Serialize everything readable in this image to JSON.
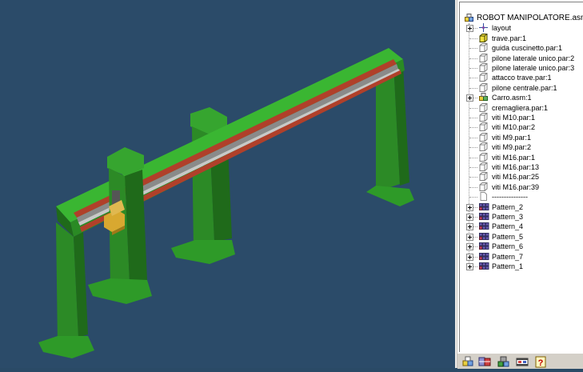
{
  "tree": {
    "root": {
      "label": "ROBOT MANIPOLATORE.asm",
      "icon": "assembly-icon"
    },
    "items": [
      {
        "label": "layout",
        "icon": "layout-axes-icon",
        "expandable": true,
        "level": 1
      },
      {
        "label": "trave.par:1",
        "icon": "part-active-icon",
        "expandable": false,
        "level": 1
      },
      {
        "label": "guida cuscinetto.par:1",
        "icon": "part-icon",
        "expandable": false,
        "level": 1
      },
      {
        "label": "pilone laterale unico.par:2",
        "icon": "part-icon",
        "expandable": false,
        "level": 1
      },
      {
        "label": "pilone laterale unico.par:3",
        "icon": "part-icon",
        "expandable": false,
        "level": 1
      },
      {
        "label": "attacco trave.par:1",
        "icon": "part-icon",
        "expandable": false,
        "level": 1
      },
      {
        "label": "pilone centrale.par:1",
        "icon": "part-icon",
        "expandable": false,
        "level": 1
      },
      {
        "label": "Carro.asm:1",
        "icon": "subassembly-icon",
        "expandable": true,
        "level": 1
      },
      {
        "label": "cremagliera.par:1",
        "icon": "part-icon",
        "expandable": false,
        "level": 1
      },
      {
        "label": "viti M10.par:1",
        "icon": "part-icon",
        "expandable": false,
        "level": 1
      },
      {
        "label": "viti M10.par:2",
        "icon": "part-icon",
        "expandable": false,
        "level": 1
      },
      {
        "label": "viti M9.par:1",
        "icon": "part-icon",
        "expandable": false,
        "level": 1
      },
      {
        "label": "viti M9.par:2",
        "icon": "part-icon",
        "expandable": false,
        "level": 1
      },
      {
        "label": "viti M16.par:1",
        "icon": "part-icon",
        "expandable": false,
        "level": 1
      },
      {
        "label": "viti M16.par:13",
        "icon": "part-icon",
        "expandable": false,
        "level": 1
      },
      {
        "label": "viti M16.par:25",
        "icon": "part-icon",
        "expandable": false,
        "level": 1
      },
      {
        "label": "viti M16.par:39",
        "icon": "part-icon",
        "expandable": false,
        "level": 1
      },
      {
        "label": "---------------",
        "icon": "separator-doc-icon",
        "expandable": false,
        "level": 1
      },
      {
        "label": "Pattern_2",
        "icon": "pattern-icon",
        "expandable": true,
        "level": 1
      },
      {
        "label": "Pattern_3",
        "icon": "pattern-icon",
        "expandable": true,
        "level": 1
      },
      {
        "label": "Pattern_4",
        "icon": "pattern-icon",
        "expandable": true,
        "level": 1
      },
      {
        "label": "Pattern_5",
        "icon": "pattern-icon",
        "expandable": true,
        "level": 1
      },
      {
        "label": "Pattern_6",
        "icon": "pattern-icon",
        "expandable": true,
        "level": 1
      },
      {
        "label": "Pattern_7",
        "icon": "pattern-icon",
        "expandable": true,
        "level": 1
      },
      {
        "label": "Pattern_1",
        "icon": "pattern-icon",
        "expandable": true,
        "level": 1
      }
    ]
  },
  "toolbar": {
    "buttons": [
      {
        "name": "show-parts-icon"
      },
      {
        "name": "show-all-icon"
      },
      {
        "name": "assembly-tree-icon"
      },
      {
        "name": "film-strip-icon"
      },
      {
        "name": "help-icon"
      }
    ]
  },
  "colors": {
    "viewport_background": "#2b4b69",
    "frame_green": "#2f9a2a",
    "rail_red": "#b0402a",
    "carriage_yellow": "#d8a830"
  }
}
